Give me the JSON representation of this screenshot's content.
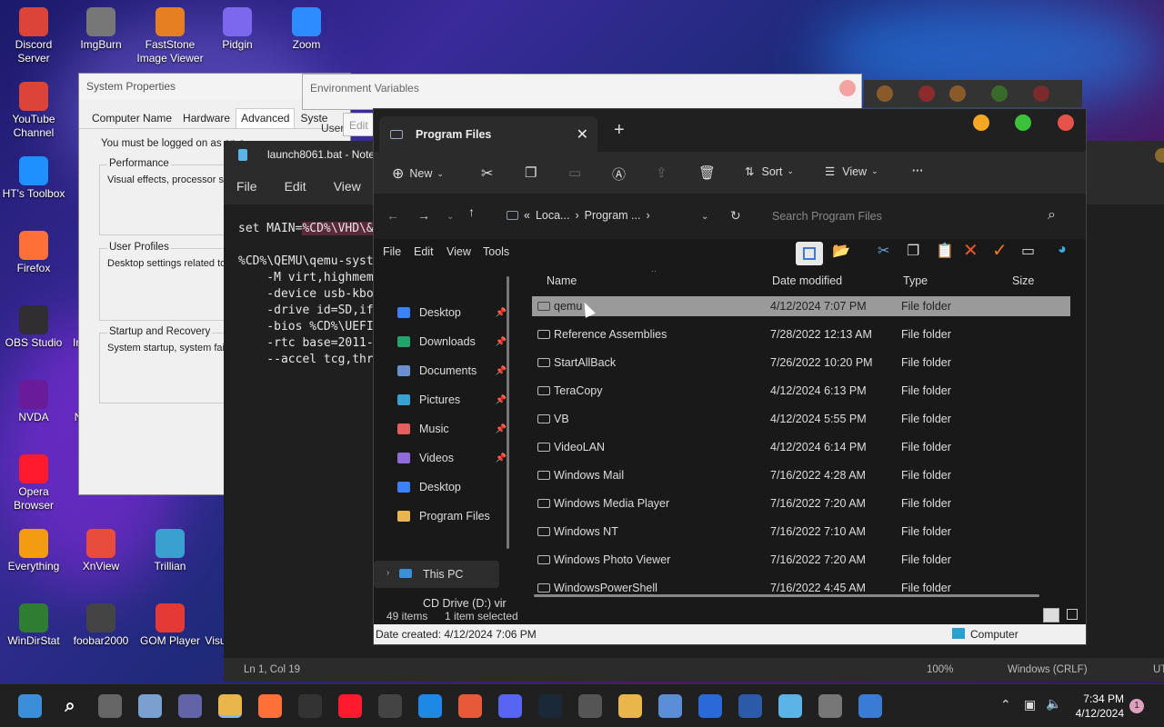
{
  "desktop": {
    "icons": [
      {
        "label": "Discord Server",
        "color": "#db4437"
      },
      {
        "label": "ImgBurn",
        "color": "#777777"
      },
      {
        "label": "FastStone Image Viewer",
        "color": "#e67e22"
      },
      {
        "label": "Pidgin",
        "color": "#7b68ee"
      },
      {
        "label": "Zoom",
        "color": "#2d8cff"
      },
      {
        "label": "YouTube Channel",
        "color": "#db4437"
      },
      {
        "label": "HT's Toolbox",
        "color": "#1e90ff"
      },
      {
        "label": "Firefox",
        "color": "#ff7139"
      },
      {
        "label": "OBS Studio",
        "color": "#302e31"
      },
      {
        "label": "NVDA",
        "color": "#6a1b9a"
      },
      {
        "label": "Opera Browser",
        "color": "#ff1b2d"
      },
      {
        "label": "Everything",
        "color": "#f39c12"
      },
      {
        "label": "XnView",
        "color": "#e74c3c"
      },
      {
        "label": "Trillian",
        "color": "#3aa0d0"
      },
      {
        "label": "WinDirStat",
        "color": "#2e7d32"
      },
      {
        "label": "foobar2000",
        "color": "#444444"
      },
      {
        "label": "GOM Player",
        "color": "#e53935"
      }
    ],
    "partial_labels": {
      "obs_right": "In",
      "nvda_right": "N",
      "gom_right": "Visu"
    }
  },
  "system_properties": {
    "title": "System Properties",
    "tabs": [
      "Computer Name",
      "Hardware",
      "Advanced",
      "Syste"
    ],
    "active_tab": "Advanced",
    "note": "You must be logged on as an a",
    "performance": {
      "title": "Performance",
      "desc": "Visual effects, processor sc"
    },
    "user_profiles": {
      "title": "User Profiles",
      "desc": "Desktop settings related to"
    },
    "startup": {
      "title": "Startup and Recovery",
      "desc": "System startup, system failu"
    }
  },
  "env_vars": {
    "title": "Environment Variables",
    "user_label": "User",
    "edit_label": "Edit"
  },
  "notepad": {
    "title": "launch8061.bat - Note",
    "menu": [
      "File",
      "Edit",
      "View"
    ],
    "lines": [
      "set MAIN=%CD%\\VHD\\&",
      "",
      "%CD%\\QEMU\\qemu-syst",
      "    -M virt,highmem",
      "    -device usb-kbo",
      "    -drive id=SD,if",
      "    -bios %CD%\\UEFI",
      "    -rtc base=2011-",
      "    --accel tcg,thr"
    ],
    "status": {
      "position": "Ln 1, Col 19",
      "zoom": "100%",
      "eol": "Windows (CRLF)",
      "enc": "UT"
    }
  },
  "explorer": {
    "tab_title": "Program Files",
    "toolbar": {
      "new": "New",
      "sort": "Sort",
      "view": "View",
      "more": "···"
    },
    "address": {
      "crumb1": "Loca...",
      "crumb2": "Program ...",
      "search_placeholder": "Search Program Files"
    },
    "menubar": [
      "File",
      "Edit",
      "View",
      "Tools"
    ],
    "columns": {
      "name": "Name",
      "date": "Date modified",
      "type": "Type",
      "size": "Size"
    },
    "nav": [
      {
        "label": "Desktop",
        "pinned": true,
        "color": "#3b82f6"
      },
      {
        "label": "Downloads",
        "pinned": true,
        "color": "#22a36b"
      },
      {
        "label": "Documents",
        "pinned": true,
        "color": "#6b8fcf"
      },
      {
        "label": "Pictures",
        "pinned": true,
        "color": "#3aa0d0"
      },
      {
        "label": "Music",
        "pinned": true,
        "color": "#e55d5d"
      },
      {
        "label": "Videos",
        "pinned": true,
        "color": "#8e6bd6"
      },
      {
        "label": "Desktop",
        "pinned": false,
        "color": "#3b82f6"
      },
      {
        "label": "Program Files",
        "pinned": false,
        "color": "#e8b64a"
      }
    ],
    "this_pc": "This PC",
    "cd_drive": "CD Drive (D:) vir",
    "rows": [
      {
        "name": "qemu",
        "date": "4/12/2024 7:07 PM",
        "type": "File folder"
      },
      {
        "name": "Reference Assemblies",
        "date": "7/28/2022 12:13 AM",
        "type": "File folder"
      },
      {
        "name": "StartAllBack",
        "date": "7/26/2022 10:20 PM",
        "type": "File folder"
      },
      {
        "name": "TeraCopy",
        "date": "4/12/2024 6:13 PM",
        "type": "File folder"
      },
      {
        "name": "VB",
        "date": "4/12/2024 5:55 PM",
        "type": "File folder"
      },
      {
        "name": "VideoLAN",
        "date": "4/12/2024 6:14 PM",
        "type": "File folder"
      },
      {
        "name": "Windows Mail",
        "date": "7/16/2022 4:28 AM",
        "type": "File folder"
      },
      {
        "name": "Windows Media Player",
        "date": "7/16/2022 7:20 AM",
        "type": "File folder"
      },
      {
        "name": "Windows NT",
        "date": "7/16/2022 7:10 AM",
        "type": "File folder"
      },
      {
        "name": "Windows Photo Viewer",
        "date": "7/16/2022 7:20 AM",
        "type": "File folder"
      },
      {
        "name": "WindowsPowerShell",
        "date": "7/16/2022 4:45 AM",
        "type": "File folder"
      }
    ],
    "status": {
      "items": "49 items",
      "selected": "1 item selected"
    },
    "bottom": {
      "created": "Date created: 4/12/2024 7:06 PM",
      "location": "Computer"
    }
  },
  "taskbar": {
    "time": "7:34 PM",
    "date": "4/12/2024",
    "notifications": "1"
  }
}
